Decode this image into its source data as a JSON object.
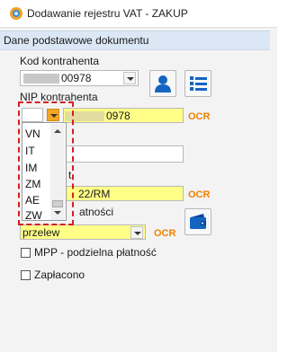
{
  "window": {
    "title": "Dodawanie rejestru VAT - ZAKUP"
  },
  "group": {
    "title": "Dane podstawowe dokumentu"
  },
  "kod_kontrahenta": {
    "label": "Kod kontrahenta",
    "value": "00978"
  },
  "nip_kontrahenta": {
    "label": "NIP kontrahenta",
    "value": "0978",
    "ocr": "OCR"
  },
  "hidden_field_3": {
    "ocr": "OCR",
    "value": "22/RM",
    "label_fragment": "t"
  },
  "platnosc": {
    "label_fragment": "atności",
    "value": "przelew",
    "ocr": "OCR"
  },
  "mpp": {
    "label": "MPP - podzielna płatność"
  },
  "zaplacono": {
    "label": "Zapłacono"
  },
  "dropdown": {
    "items": [
      "VN",
      "IT",
      "IM",
      "ZM",
      "AE",
      "ZW"
    ]
  },
  "icons": {
    "app": "windows-app-icon",
    "person": "person-icon",
    "list": "list-icon",
    "wallet": "wallet-icon"
  },
  "colors": {
    "accent": "#1565c0",
    "highlight_field": "#ffff88",
    "ocr": "#f08000",
    "annotation": "#d42020"
  }
}
